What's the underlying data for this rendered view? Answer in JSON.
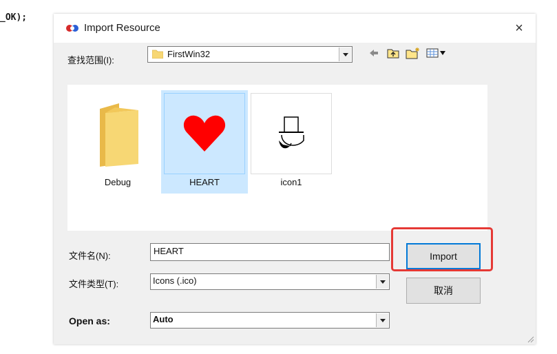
{
  "background": {
    "code_text": "_OK);"
  },
  "dialog": {
    "title": "Import Resource",
    "close_glyph": "×",
    "look_in": {
      "label": "查找范围(I):",
      "value": "FirstWin32"
    },
    "files": [
      {
        "name": "Debug",
        "kind": "folder",
        "selected": false
      },
      {
        "name": "HEART",
        "kind": "heart-icon",
        "selected": true
      },
      {
        "name": "icon1",
        "kind": "hat-icon",
        "selected": false
      }
    ],
    "filename": {
      "label": "文件名(N):",
      "value": "HEART"
    },
    "filetype": {
      "label": "文件类型(T):",
      "value": "Icons (.ico)"
    },
    "open_as": {
      "label": "Open as:",
      "value": "Auto"
    },
    "buttons": {
      "import": "Import",
      "cancel": "取消"
    }
  },
  "colors": {
    "highlight": "#e53935",
    "selection": "#cce8ff",
    "folder": "#f7d774",
    "heart": "#ff0000"
  }
}
